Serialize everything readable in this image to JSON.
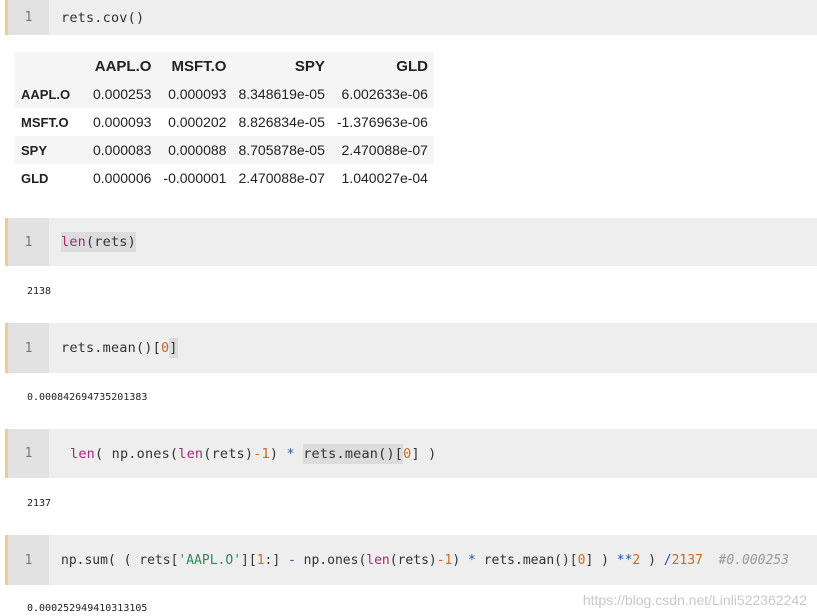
{
  "cells": [
    {
      "line": "1",
      "code": "rets.cov()"
    },
    {
      "line": "1",
      "code": "len(rets)",
      "fn": "len",
      "args": "(rets)"
    },
    {
      "line": "1",
      "code_a": "rets.mean()[",
      "code_num": "0",
      "code_b": "]"
    },
    {
      "line": "1",
      "t1": "len",
      "t2": "( np.ones(",
      "t3": "len",
      "t4": "(rets)",
      "t5": "-1",
      "t6": ") ",
      "t7": "*",
      "t8": " ",
      "t9": "rets.mean()[",
      "t10": "0",
      "t11": "] )"
    },
    {
      "line": "1",
      "p1": "np.sum( ( rets[",
      "p2": "'AAPL.O'",
      "p3": "][",
      "p4": "1",
      "p5": ":] ",
      "p6": "-",
      "p7": " np.ones(",
      "p8": "len",
      "p9": "(rets)",
      "p10": "-1",
      "p11": ") ",
      "p12": "*",
      "p13": " rets.mean()[",
      "p14": "0",
      "p15": "] ) ",
      "p16": "**",
      "p17": "2",
      "p18": " ) ",
      "p19": "/",
      "p20": "2137",
      "p21": "  #0.000253"
    }
  ],
  "table": {
    "columns": [
      "",
      "AAPL.O",
      "MSFT.O",
      "SPY",
      "GLD"
    ],
    "rows": [
      {
        "label": "AAPL.O",
        "values": [
          "0.000253",
          "0.000093",
          "8.348619e-05",
          "6.002633e-06"
        ]
      },
      {
        "label": "MSFT.O",
        "values": [
          "0.000093",
          "0.000202",
          "8.826834e-05",
          "-1.376963e-06"
        ]
      },
      {
        "label": "SPY",
        "values": [
          "0.000083",
          "0.000088",
          "8.705878e-05",
          "2.470088e-07"
        ]
      },
      {
        "label": "GLD",
        "values": [
          "0.000006",
          "-0.000001",
          "2.470088e-07",
          "1.040027e-04"
        ]
      }
    ]
  },
  "outputs": [
    "2138",
    "0.000842694735201383",
    "2137",
    "0.000252949410313105"
  ],
  "watermark": "https://blog.csdn.net/Linli522362242"
}
